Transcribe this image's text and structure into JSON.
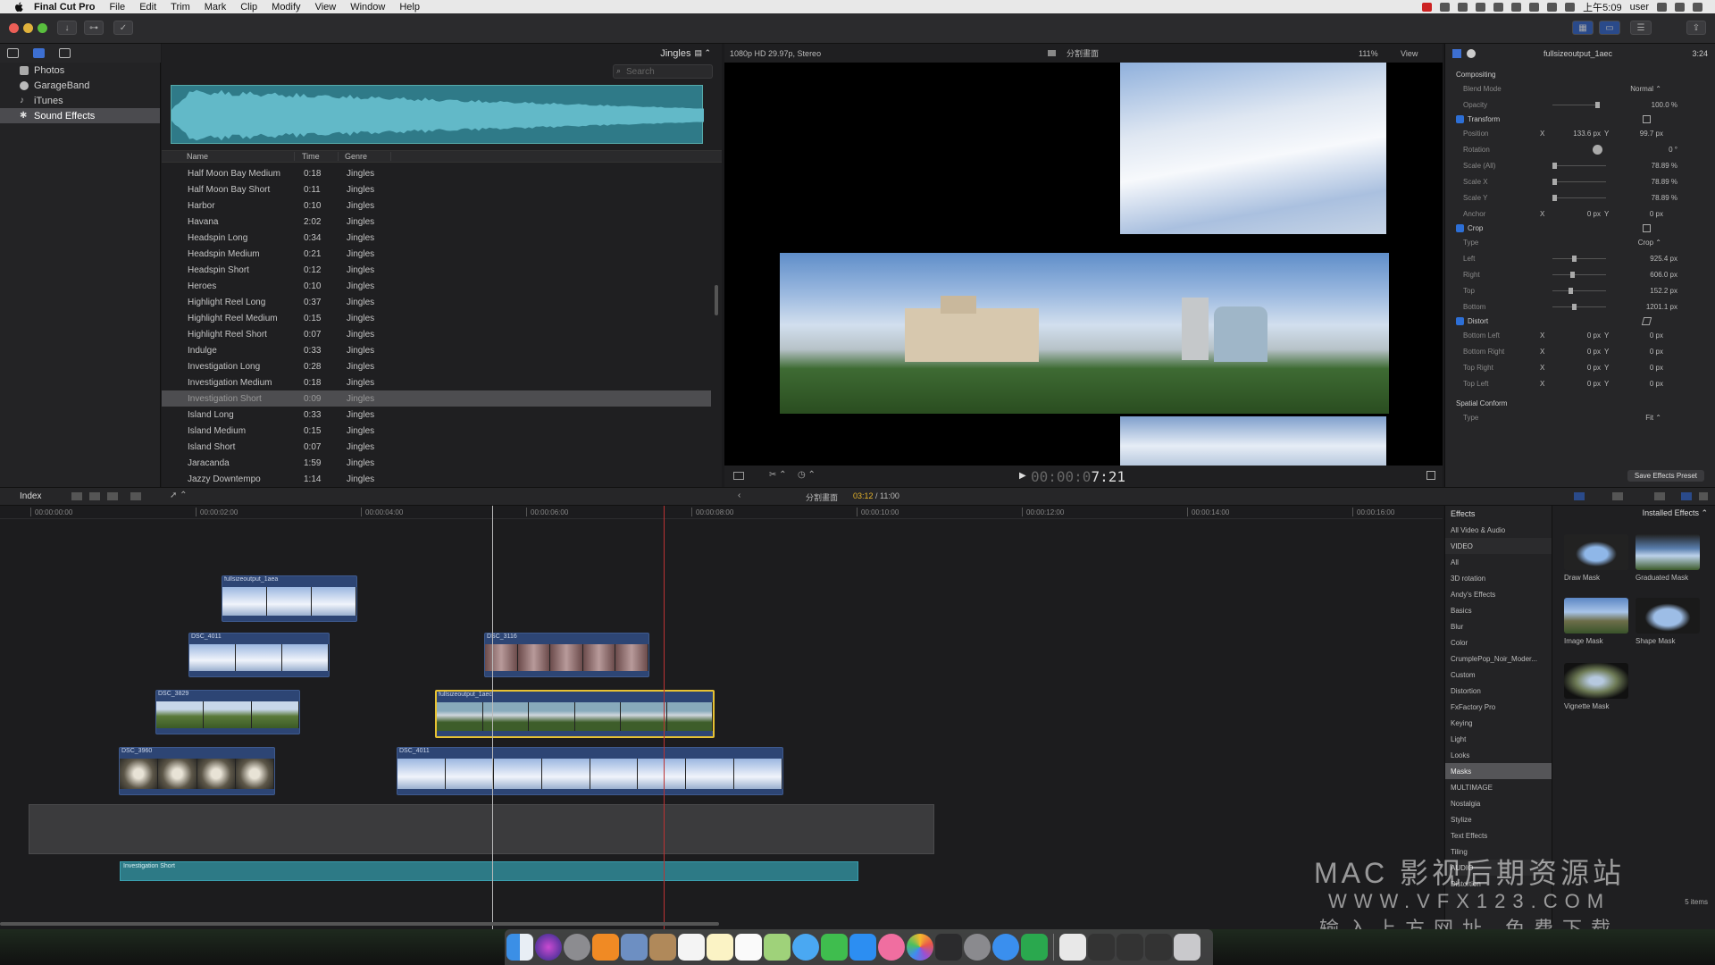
{
  "menubar": {
    "items": [
      "Final Cut Pro",
      "File",
      "Edit",
      "Trim",
      "Mark",
      "Clip",
      "Modify",
      "View",
      "Window",
      "Help"
    ],
    "clock": "上午5:09",
    "user": "user"
  },
  "library": {
    "items": [
      {
        "label": "Photos",
        "icon": "photos-icon"
      },
      {
        "label": "GarageBand",
        "icon": "guitar-icon"
      },
      {
        "label": "iTunes",
        "icon": "music-note-icon"
      },
      {
        "label": "Sound Effects",
        "icon": "speaker-icon",
        "selected": true
      }
    ]
  },
  "browser": {
    "category": "Jingles",
    "search_placeholder": "Search",
    "columns": {
      "name": "Name",
      "time": "Time",
      "genre": "Genre"
    },
    "rows": [
      {
        "name": "Half Moon Bay Medium",
        "time": "0:18",
        "genre": "Jingles"
      },
      {
        "name": "Half Moon Bay Short",
        "time": "0:11",
        "genre": "Jingles"
      },
      {
        "name": "Harbor",
        "time": "0:10",
        "genre": "Jingles"
      },
      {
        "name": "Havana",
        "time": "2:02",
        "genre": "Jingles"
      },
      {
        "name": "Headspin Long",
        "time": "0:34",
        "genre": "Jingles"
      },
      {
        "name": "Headspin Medium",
        "time": "0:21",
        "genre": "Jingles"
      },
      {
        "name": "Headspin Short",
        "time": "0:12",
        "genre": "Jingles"
      },
      {
        "name": "Heroes",
        "time": "0:10",
        "genre": "Jingles"
      },
      {
        "name": "Highlight Reel Long",
        "time": "0:37",
        "genre": "Jingles"
      },
      {
        "name": "Highlight Reel Medium",
        "time": "0:15",
        "genre": "Jingles"
      },
      {
        "name": "Highlight Reel Short",
        "time": "0:07",
        "genre": "Jingles"
      },
      {
        "name": "Indulge",
        "time": "0:33",
        "genre": "Jingles"
      },
      {
        "name": "Investigation Long",
        "time": "0:28",
        "genre": "Jingles"
      },
      {
        "name": "Investigation Medium",
        "time": "0:18",
        "genre": "Jingles"
      },
      {
        "name": "Investigation Short",
        "time": "0:09",
        "genre": "Jingles",
        "selected": true
      },
      {
        "name": "Island Long",
        "time": "0:33",
        "genre": "Jingles"
      },
      {
        "name": "Island Medium",
        "time": "0:15",
        "genre": "Jingles"
      },
      {
        "name": "Island Short",
        "time": "0:07",
        "genre": "Jingles"
      },
      {
        "name": "Jaracanda",
        "time": "1:59",
        "genre": "Jingles"
      },
      {
        "name": "Jazzy Downtempo",
        "time": "1:14",
        "genre": "Jingles"
      }
    ]
  },
  "viewer": {
    "format": "1080p HD 29.97p, Stereo",
    "title": "分割畫面",
    "zoom": "111%",
    "view_label": "View",
    "timecode_dim": "00:00:0",
    "timecode_bright": "7:21"
  },
  "inspector": {
    "clip_name": "fullsizeoutput_1aec",
    "duration": "3:24",
    "compositing": "Compositing",
    "blend_mode_label": "Blend Mode",
    "blend_mode": "Normal ⌃",
    "opacity_label": "Opacity",
    "opacity": "100.0 %",
    "transform": "Transform",
    "position_label": "Position",
    "position_x": "133.6 px",
    "position_y": "99.7 px",
    "rotation_label": "Rotation",
    "rotation": "0 °",
    "scale_all_label": "Scale (All)",
    "scale_all": "78.89 %",
    "scale_x_label": "Scale X",
    "scale_x": "78.89 %",
    "scale_y_label": "Scale Y",
    "scale_y": "78.89 %",
    "anchor_label": "Anchor",
    "anchor_x": "0 px",
    "anchor_y": "0 px",
    "crop": "Crop",
    "crop_type_label": "Type",
    "crop_type": "Crop ⌃",
    "left_label": "Left",
    "left": "925.4 px",
    "right_label": "Right",
    "right": "606.0 px",
    "top_label": "Top",
    "top": "152.2 px",
    "bottom_label": "Bottom",
    "bottom": "1201.1 px",
    "distort": "Distort",
    "bl_label": "Bottom Left",
    "br_label": "Bottom Right",
    "tr_label": "Top Right",
    "tl_label": "Top Left",
    "zero": "0 px",
    "x": "X",
    "y": "Y",
    "spatial": "Spatial Conform",
    "spatial_type_label": "Type",
    "spatial_type": "Fit ⌃",
    "save_preset": "Save Effects Preset"
  },
  "timeline": {
    "index": "Index",
    "project": "分割畫面",
    "position": "03:12",
    "duration": " / 11:00",
    "ruler": [
      "00:00:00:00",
      "00:00:02:00",
      "00:00:04:00",
      "00:00:06:00",
      "00:00:08:00",
      "00:00:10:00",
      "00:00:12:00",
      "00:00:14:00",
      "00:00:16:00"
    ],
    "clips": [
      {
        "name": "fullsizeoutput_1aea"
      },
      {
        "name": "DSC_4011"
      },
      {
        "name": "DSC_3116"
      },
      {
        "name": "DSC_3829"
      },
      {
        "name": "fullsizeoutput_1aec"
      },
      {
        "name": "DSC_3960"
      },
      {
        "name": "DSC_4011"
      }
    ],
    "audio_clip": "Investigation Short"
  },
  "effects": {
    "header": "Effects",
    "installed": "Installed Effects ⌃",
    "categories": [
      "All Video & Audio",
      "VIDEO",
      "All",
      "3D rotation",
      "Andy's Effects",
      "Basics",
      "Blur",
      "Color",
      "CrumplePop_Noir_Moder...",
      "Custom",
      "Distortion",
      "FxFactory Pro",
      "Keying",
      "Light",
      "Looks",
      "Masks",
      "MULTIMAGE",
      "Nostalgia",
      "Stylize",
      "Text Effects",
      "Tiling",
      "AUDIO",
      "Distortion"
    ],
    "tiles": [
      "Draw Mask",
      "Graduated Mask",
      "Image Mask",
      "Shape Mask",
      "Vignette Mask"
    ],
    "count": "5 items"
  },
  "watermark": {
    "line1": "MAC 影视后期资源站",
    "line2": "WWW.VFX123.COM",
    "line3": "输入上方网址 免费下载"
  },
  "colors": {
    "accent": "#e5b32a",
    "selection": "#2d6fd6",
    "clip": "#2d4574",
    "audio": "#2d7a86"
  }
}
